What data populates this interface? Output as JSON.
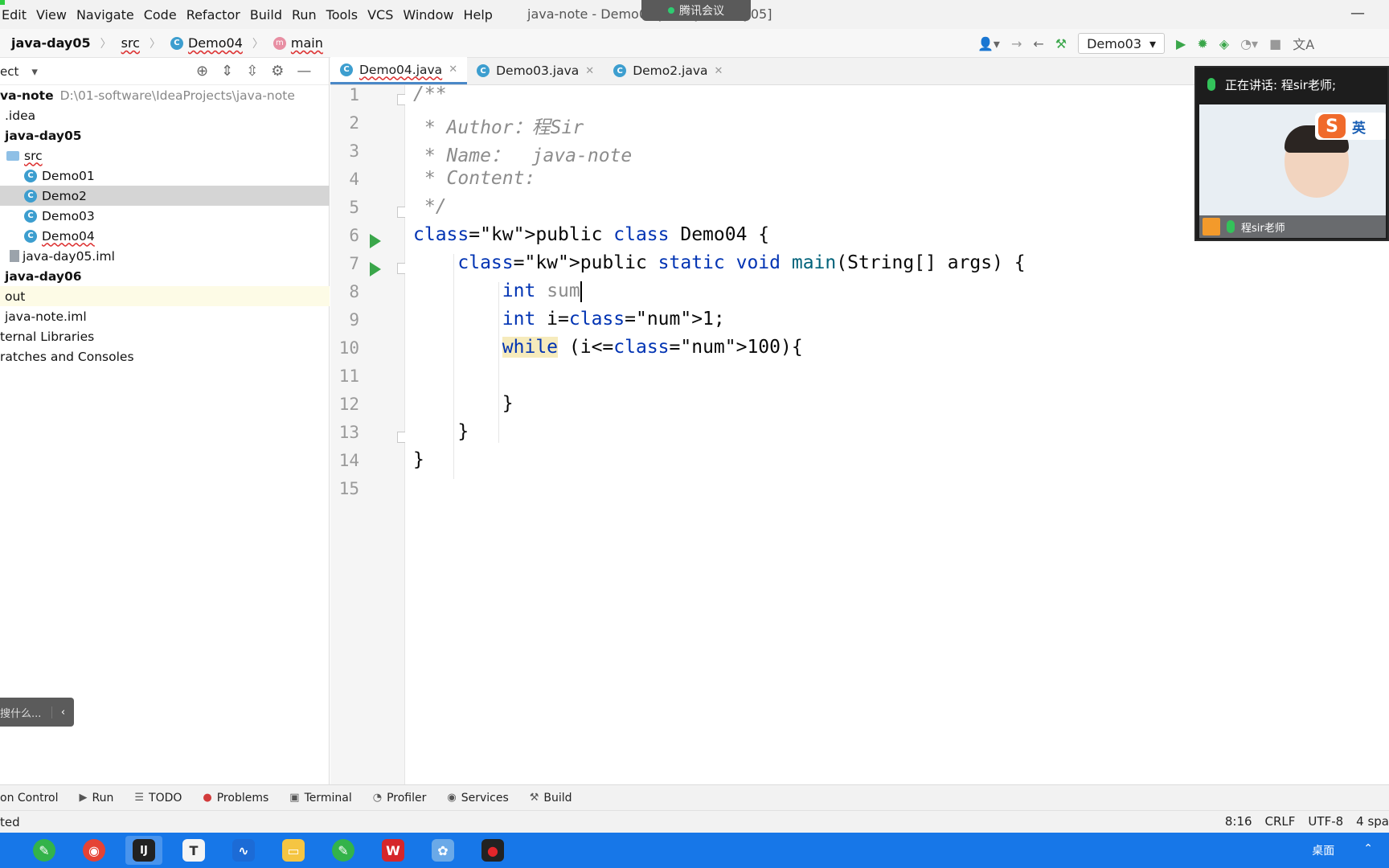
{
  "window": {
    "title": "java-note - Demo04.java [java-day05]",
    "meeting_pill": "腾讯会议",
    "minimize": "—"
  },
  "menu": [
    "Edit",
    "View",
    "Navigate",
    "Code",
    "Refactor",
    "Build",
    "Run",
    "Tools",
    "VCS",
    "Window",
    "Help"
  ],
  "breadcrumb": {
    "project": "java-day05",
    "folder": "src",
    "class": "Demo04",
    "method": "main"
  },
  "toolbar": {
    "run_config": "Demo03",
    "translate": "文A"
  },
  "project_panel": {
    "title": "ect",
    "tree": [
      {
        "label": "va-note",
        "path": "D:\\01-software\\IdeaProjects\\java-note",
        "bold": true
      },
      {
        "label": ".idea"
      },
      {
        "label": "java-day05",
        "bold": true
      },
      {
        "label": "src"
      },
      {
        "label": "Demo01"
      },
      {
        "label": "Demo2",
        "selected": true
      },
      {
        "label": "Demo03"
      },
      {
        "label": "Demo04"
      },
      {
        "label": "java-day05.iml"
      },
      {
        "label": "java-day06",
        "bold": true
      },
      {
        "label": "out"
      },
      {
        "label": "java-note.iml"
      },
      {
        "label": "ternal Libraries"
      },
      {
        "label": "ratches and Consoles"
      }
    ],
    "search_toast": "搜什么..."
  },
  "tabs": [
    {
      "label": "Demo04.java",
      "active": true
    },
    {
      "label": "Demo03.java"
    },
    {
      "label": "Demo2.java"
    }
  ],
  "editor": {
    "line_numbers": [
      "1",
      "2",
      "3",
      "4",
      "5",
      "6",
      "7",
      "8",
      "9",
      "10",
      "11",
      "12",
      "13",
      "14",
      "15"
    ],
    "lines": [
      "/**",
      " * Author：程Sir",
      " * Name：  java-note",
      " * Content:",
      " */",
      "public class Demo04 {",
      "    public static void main(String[] args) {",
      "        int sum",
      "        int i=1;",
      "        while (i<=100){",
      "",
      "        }",
      "    }",
      "}",
      ""
    ]
  },
  "bottom_tools": [
    "on Control",
    "Run",
    "TODO",
    "Problems",
    "Terminal",
    "Profiler",
    "Services",
    "Build"
  ],
  "status": {
    "left": "ted",
    "position": "8:16",
    "line_sep": "CRLF",
    "encoding": "UTF-8",
    "indent": "4 spa"
  },
  "taskbar": {
    "tray_text": "桌面"
  },
  "meeting": {
    "speaking": "正在讲话: 程sir老师;",
    "name": "程sir老师",
    "ime_label": "英"
  }
}
